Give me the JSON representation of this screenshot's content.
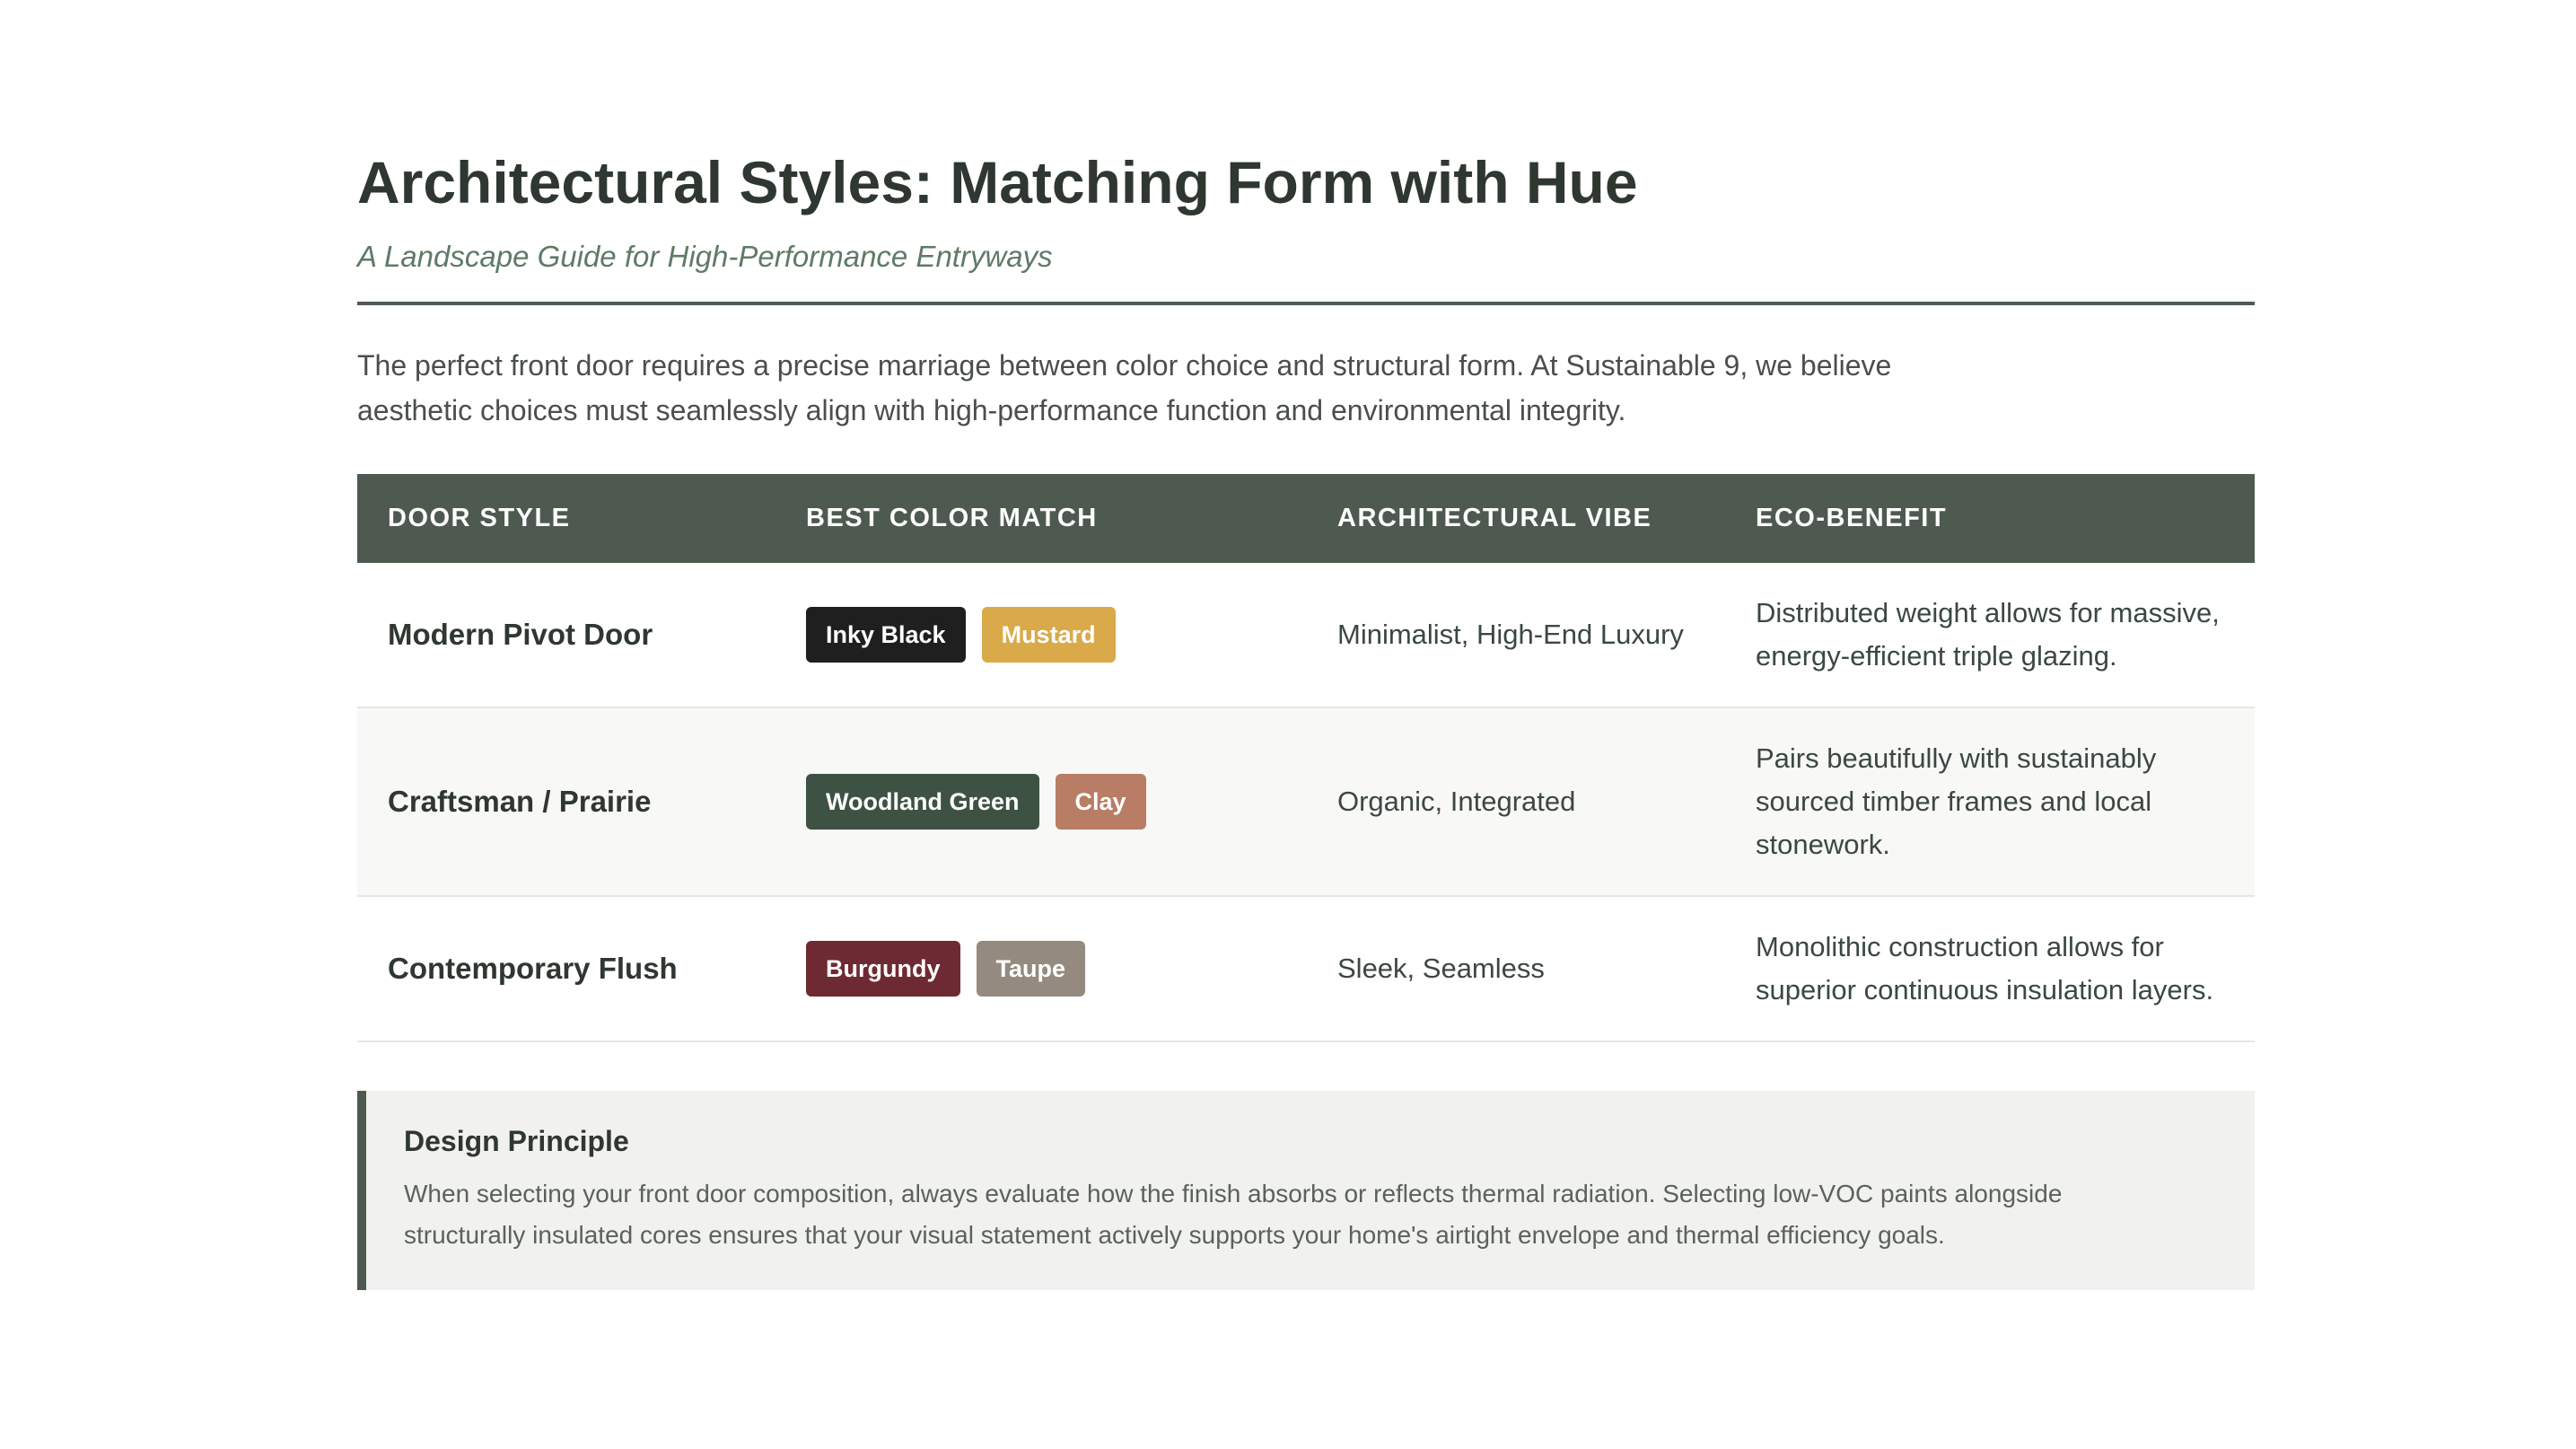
{
  "header": {
    "title": "Architectural Styles: Matching Form with Hue",
    "subtitle": "A Landscape Guide for High-Performance Entryways"
  },
  "intro": "The perfect front door requires a precise marriage between color choice and structural form. At Sustainable 9, we believe aesthetic choices must seamlessly align with high-performance function and environmental integrity.",
  "table": {
    "columns": [
      "DOOR STYLE",
      "BEST COLOR MATCH",
      "ARCHITECTURAL VIBE",
      "ECO-BENEFIT"
    ],
    "rows": [
      {
        "style": "Modern Pivot Door",
        "colors": [
          {
            "label": "Inky Black",
            "color": "#1f1f1f"
          },
          {
            "label": "Mustard",
            "color": "#d9a94a"
          }
        ],
        "vibe": "Minimalist, High-End Luxury",
        "benefit": "Distributed weight allows for massive, energy-efficient triple glazing."
      },
      {
        "style": "Craftsman / Prairie",
        "colors": [
          {
            "label": "Woodland Green",
            "color": "#3e5244"
          },
          {
            "label": "Clay",
            "color": "#b97c65"
          }
        ],
        "vibe": "Organic, Integrated",
        "benefit": "Pairs beautifully with sustainably sourced timber frames and local stonework."
      },
      {
        "style": "Contemporary Flush",
        "colors": [
          {
            "label": "Burgundy",
            "color": "#6e2a33"
          },
          {
            "label": "Taupe",
            "color": "#948a80"
          }
        ],
        "vibe": "Sleek, Seamless",
        "benefit": "Monolithic construction allows for superior continuous insulation layers."
      }
    ]
  },
  "principle": {
    "title": "Design Principle",
    "text": "When selecting your front door composition, always evaluate how the finish absorbs or reflects thermal radiation. Selecting low-VOC paints alongside structurally insulated cores ensures that your visual statement actively supports your home's airtight envelope and thermal efficiency goals."
  },
  "theme": {
    "accent": "#4e5a50",
    "subtitle_color": "#5f7a66"
  }
}
